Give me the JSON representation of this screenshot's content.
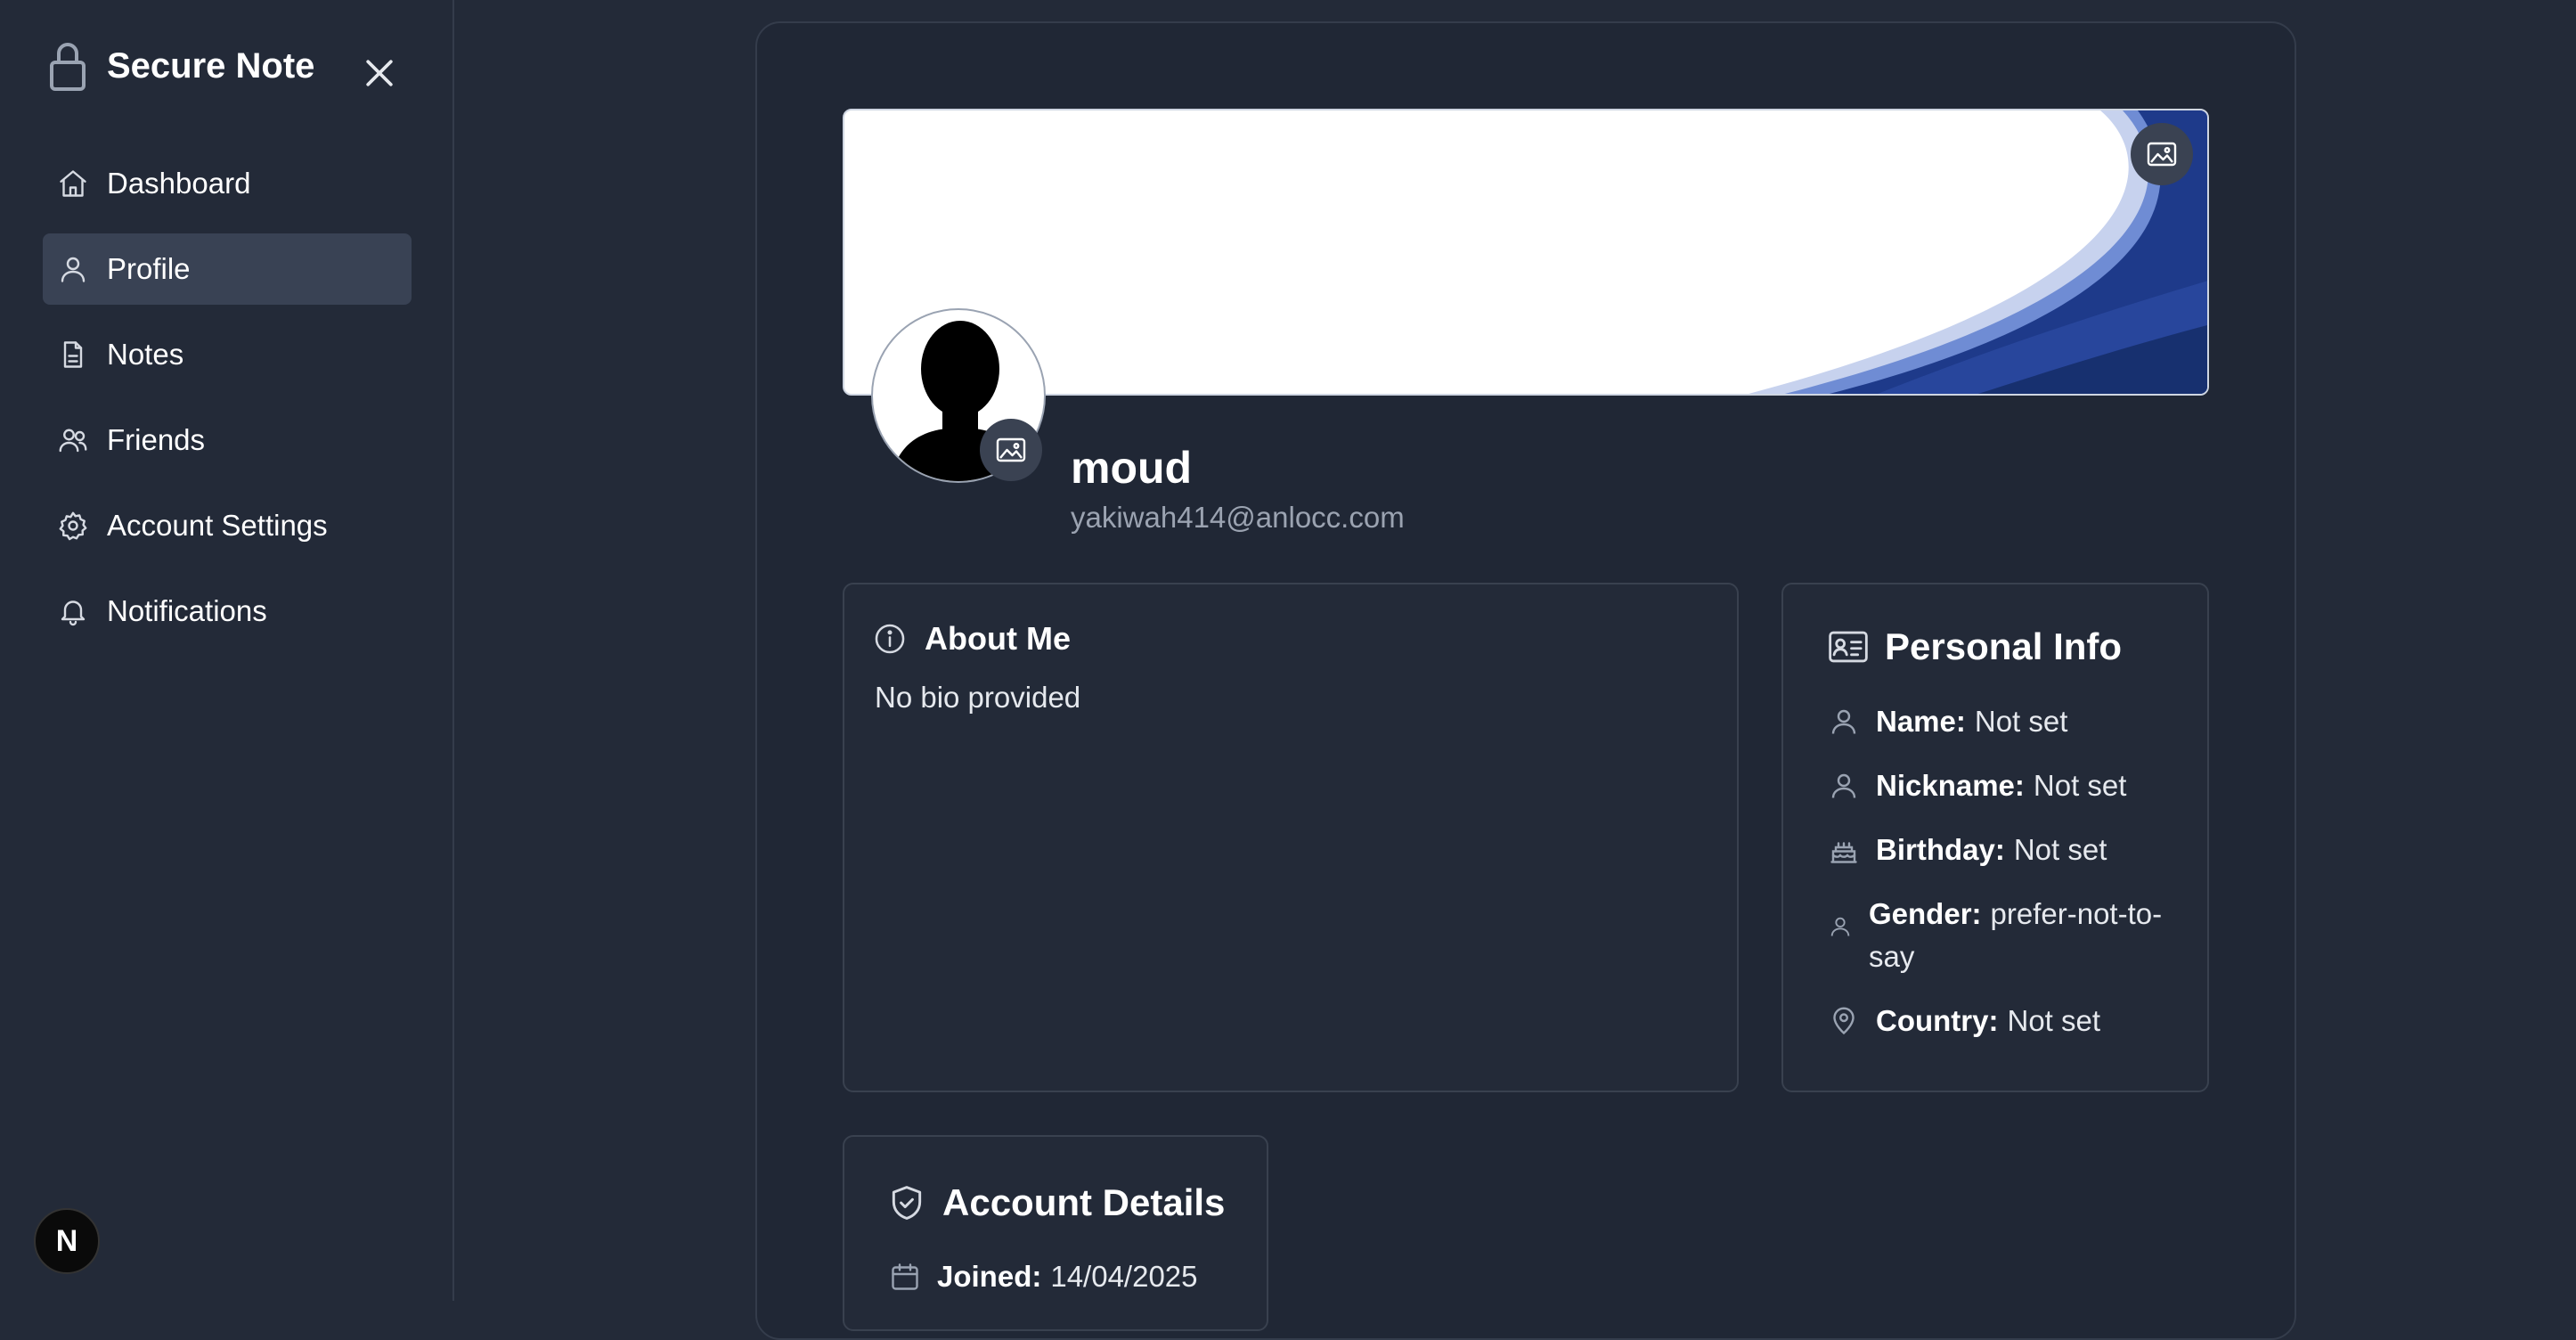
{
  "app": {
    "title": "Secure Note"
  },
  "sidebar": {
    "items": [
      {
        "label": "Dashboard",
        "icon": "home-icon"
      },
      {
        "label": "Profile",
        "icon": "user-icon",
        "active": true
      },
      {
        "label": "Notes",
        "icon": "file-text-icon"
      },
      {
        "label": "Friends",
        "icon": "users-icon"
      },
      {
        "label": "Account Settings",
        "icon": "gear-icon"
      },
      {
        "label": "Notifications",
        "icon": "bell-icon"
      }
    ],
    "badge": "N"
  },
  "profile": {
    "username": "moud",
    "email": "yakiwah414@anlocc.com"
  },
  "about": {
    "title": "About Me",
    "bio": "No bio provided"
  },
  "personal": {
    "title": "Personal Info",
    "fields": [
      {
        "label": "Name:",
        "value": "Not set",
        "icon": "user-icon"
      },
      {
        "label": "Nickname:",
        "value": "Not set",
        "icon": "user-icon"
      },
      {
        "label": "Birthday:",
        "value": "Not set",
        "icon": "cake-icon"
      },
      {
        "label": "Gender:",
        "value": "prefer-not-to-say",
        "icon": "user-icon"
      },
      {
        "label": "Country:",
        "value": "Not set",
        "icon": "map-pin-icon"
      }
    ]
  },
  "account": {
    "title": "Account Details",
    "joined_label": "Joined:",
    "joined_value": "14/04/2025"
  },
  "colors": {
    "background": "#232a38",
    "active_nav": "#394254",
    "muted_text": "#9ba3b1",
    "cover_wave": "#1e3a8a"
  }
}
